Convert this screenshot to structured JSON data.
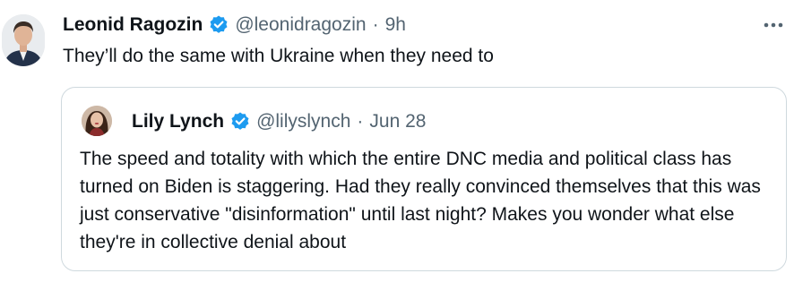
{
  "tweet": {
    "author_name": "Leonid Ragozin",
    "handle": "@leonidragozin",
    "separator": "·",
    "time": "9h",
    "text": "They’ll do the same with Ukraine when they need to"
  },
  "quoted_tweet": {
    "author_name": "Lily Lynch",
    "handle": "@lilyslynch",
    "separator": "·",
    "date": "Jun 28",
    "text": "The speed and totality with which the entire DNC media and political class has turned on Biden is staggering. Had they really convinced themselves that this was just conservative \"disinformation\" until last night? Makes you wonder what else they're in collective denial about"
  },
  "icons": {
    "verified": "verified-badge-icon",
    "more": "more-options-icon"
  },
  "colors": {
    "verified_blue": "#1d9bf0",
    "muted_text": "#536471",
    "border": "#cfd9de"
  }
}
